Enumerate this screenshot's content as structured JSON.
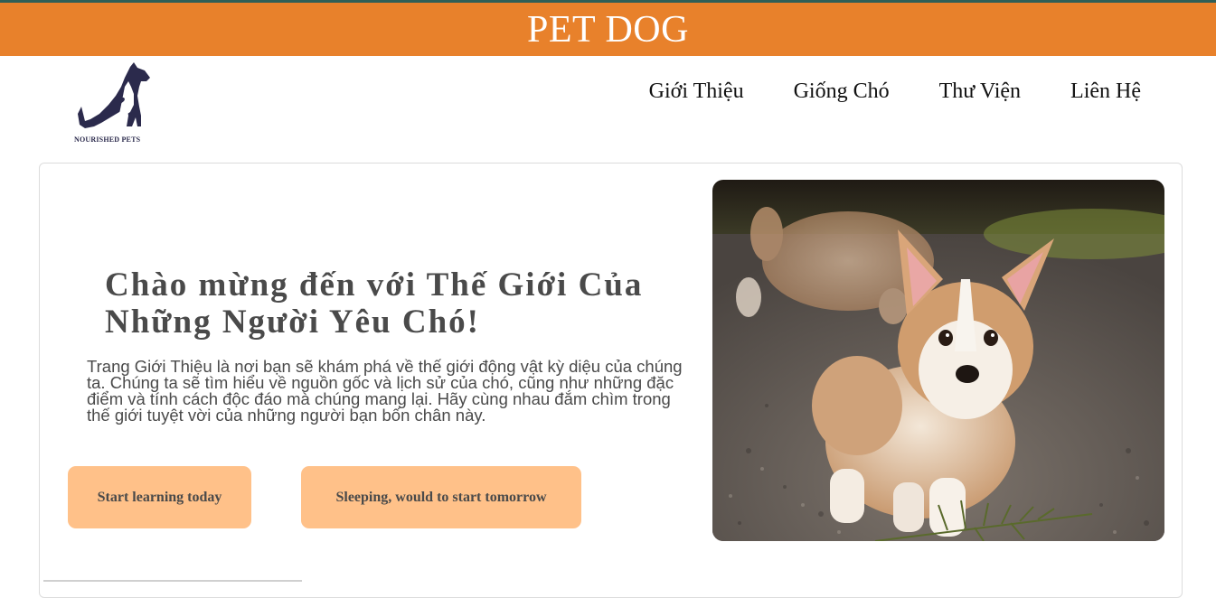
{
  "banner": {
    "title": "PET DOG"
  },
  "logo": {
    "text": "NOURISHED PETS",
    "icon": "dog-cat-logo-icon"
  },
  "nav": {
    "items": [
      {
        "label": "Giới Thiệu"
      },
      {
        "label": "Giống Chó"
      },
      {
        "label": "Thư Viện"
      },
      {
        "label": "Liên Hệ"
      }
    ]
  },
  "hero": {
    "title": "Chào mừng đến với Thế Giới Của Những Người Yêu Chó!",
    "description": "Trang Giới Thiệu là nơi bạn sẽ khám phá về thế giới động vật kỳ diệu của chúng ta. Chúng ta sẽ tìm hiểu về nguồn gốc và lịch sử của chó, cũng như những đặc điểm và tính cách độc đáo mà chúng mang lại. Hãy cùng nhau đắm chìm trong thế giới tuyệt vời của những người bạn bốn chân này.",
    "buttons": {
      "start": "Start learning today",
      "sleep": "Sleeping, would to start tomorrow"
    },
    "image": "corgi-puppy-photo"
  },
  "colors": {
    "banner": "#e8812b",
    "button": "#ffc189",
    "text": "#4a4a4a",
    "logo": "#2b2a4c"
  }
}
